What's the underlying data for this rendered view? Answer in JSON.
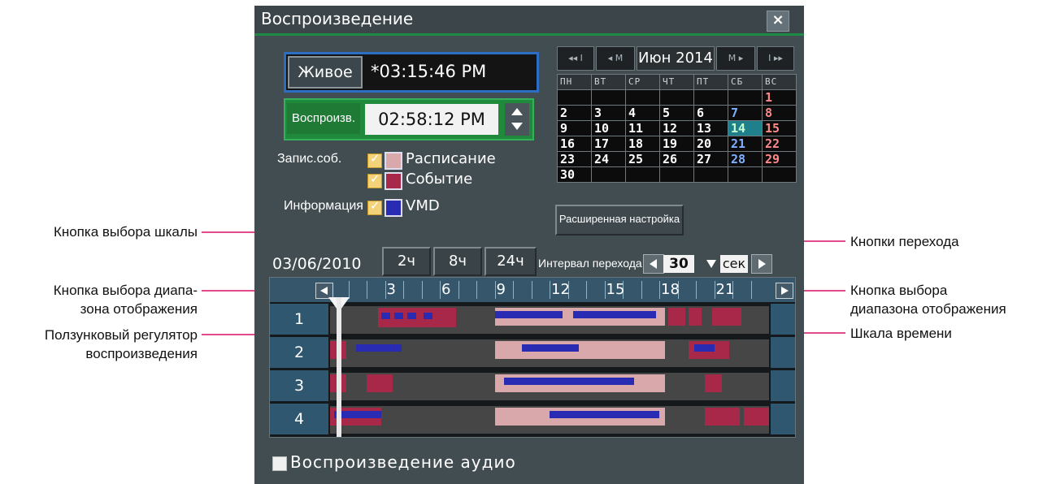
{
  "window": {
    "title": "Воспроизведение",
    "close_glyph": "×"
  },
  "live": {
    "button_label": "Живое",
    "time": "*03:15:46 PM"
  },
  "playback": {
    "button_label": "Воспроизв.",
    "time": "02:58:12 PM"
  },
  "legend": {
    "record_event_label": "Запис.соб.",
    "schedule_label": "Расписание",
    "event_label": "Событие",
    "info_label": "Информация",
    "vmd_label": "VMD",
    "colors": {
      "schedule": "#d9a8ab",
      "event": "#a8284a",
      "vmd": "#2a2bb3"
    }
  },
  "calendar": {
    "nav_prev_year": "◂◂ I",
    "nav_prev_month": "◂ M",
    "month_label": "Июн 2014",
    "nav_next_month": "M ▸",
    "nav_next_year": "I ▸▸",
    "weekdays": [
      "ПН",
      "ВТ",
      "СР",
      "ЧТ",
      "ПТ",
      "СБ",
      "ВС"
    ],
    "weeks": [
      [
        "",
        "",
        "",
        "",
        "",
        "",
        "1"
      ],
      [
        "2",
        "3",
        "4",
        "5",
        "6",
        "7",
        "8"
      ],
      [
        "9",
        "10",
        "11",
        "12",
        "13",
        "14",
        "15"
      ],
      [
        "16",
        "17",
        "18",
        "19",
        "20",
        "21",
        "22"
      ],
      [
        "23",
        "24",
        "25",
        "26",
        "27",
        "28",
        "29"
      ],
      [
        "30",
        "",
        "",
        "",
        "",
        "",
        ""
      ]
    ],
    "selected_day": "14"
  },
  "advanced_button": "Расширенная настройка",
  "timeline": {
    "date": "03/06/2010",
    "scale_buttons": [
      "2ч",
      "8ч",
      "24ч"
    ],
    "jump_label": "Интервал перехода",
    "jump_value": "30",
    "jump_unit": "сек",
    "hours": [
      "3",
      "6",
      "9",
      "12",
      "15",
      "18",
      "21"
    ],
    "rows": [
      "1",
      "2",
      "3",
      "4"
    ]
  },
  "audio": {
    "label": "Воспроизведение аудио"
  },
  "callouts": {
    "scale_select": "Кнопка выбора шкалы",
    "range_select_left": "Кнопка выбора диапа-\nзона отображения",
    "slider": "Ползунковый регулятор\nвоспроизведения",
    "jump_buttons": "Кнопки перехода",
    "range_select_right": "Кнопка выбора\nдиапазона отображения",
    "time_scale": "Шкала времени"
  }
}
